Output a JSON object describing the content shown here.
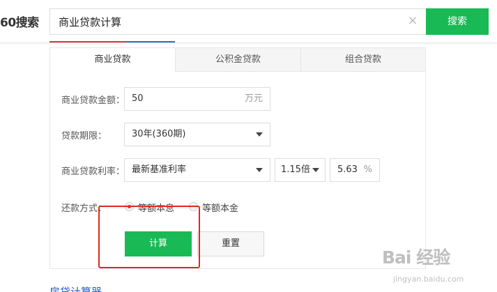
{
  "header": {
    "logo": "60搜索",
    "search_value": "商业贷款计算",
    "clear_glyph": "×",
    "search_button": "搜索"
  },
  "tabs": [
    {
      "label": "商业贷款",
      "active": true
    },
    {
      "label": "公积金贷款",
      "active": false
    },
    {
      "label": "组合贷款",
      "active": false
    }
  ],
  "form": {
    "amount": {
      "label": "商业贷款金额：",
      "value": "50",
      "unit": "万元"
    },
    "term": {
      "label": "贷款期限：",
      "value": "30年(360期)"
    },
    "rate": {
      "label": "商业贷款利率：",
      "base": "最新基准利率",
      "multiplier": "1.15倍",
      "value": "5.63",
      "unit": "%"
    },
    "repayment": {
      "label": "还款方式：",
      "options": [
        {
          "label": "等额本息",
          "checked": true
        },
        {
          "label": "等额本金",
          "checked": false
        }
      ]
    },
    "calculate_button": "计算",
    "reset_button": "重置"
  },
  "bottom_link": "房贷计算器",
  "watermark": {
    "logo": "Bai 经验",
    "sub": "jingyan.baidu.com"
  },
  "colors": {
    "accent_green": "#19b955",
    "highlight_red": "#e0281f",
    "link_blue": "#2b5dc0"
  }
}
